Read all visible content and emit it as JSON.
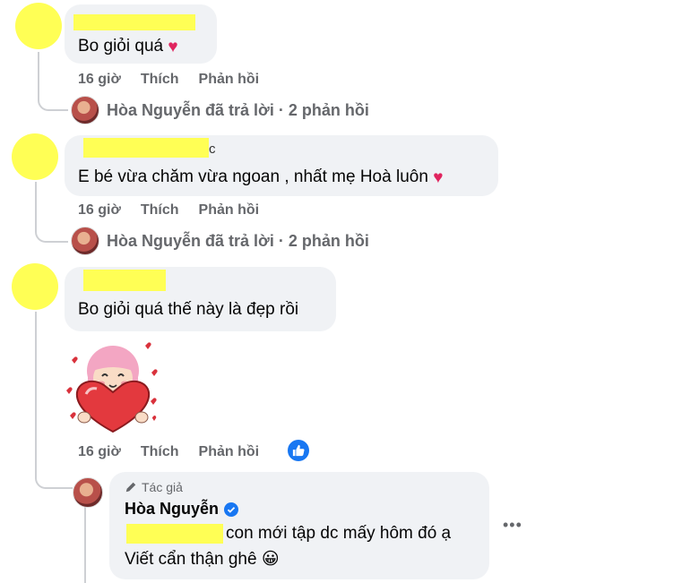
{
  "comments": [
    {
      "text": "Bo giỏi quá",
      "emoji": "❤️",
      "time": "16 giờ",
      "like": "Thích",
      "reply": "Phản hồi",
      "replies_line": "Hòa Nguyễn đã trả lời · 2 phản hồi"
    },
    {
      "name_fragment": "c",
      "text": "E bé vừa chăm vừa ngoan , nhất mẹ Hoà luôn",
      "emoji": "❤️",
      "time": "16 giờ",
      "like": "Thích",
      "reply": "Phản hồi",
      "replies_line": "Hòa Nguyễn đã trả lời · 2 phản hồi"
    },
    {
      "text": "Bo giỏi quá thế này là đẹp rồi",
      "time": "16 giờ",
      "like": "Thích",
      "reply": "Phản hồi"
    }
  ],
  "author_reply": {
    "badge": "Tác giả",
    "name": "Hòa Nguyễn",
    "line1": "con mới tập dc mấy hôm đó ạ",
    "line2": "Viết cẩn thận ghê",
    "emoji": "😀"
  },
  "colors": {
    "highlight": "#ffff55",
    "bubble": "#f0f2f5",
    "meta": "#65676b",
    "like_blue": "#1877f2"
  }
}
